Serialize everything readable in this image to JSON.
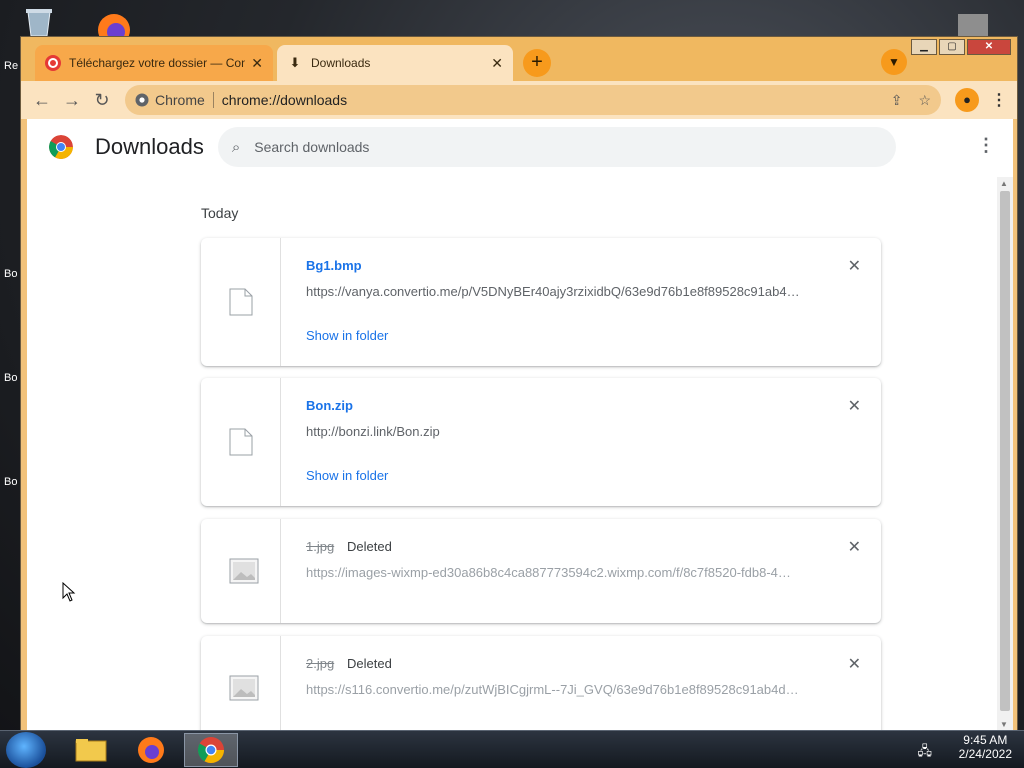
{
  "desktop": {
    "labels": [
      "Re",
      "Bo",
      "Bo",
      "Bo"
    ]
  },
  "browser": {
    "tabs": [
      {
        "title": "Téléchargez votre dossier — Con",
        "active": false
      },
      {
        "title": "Downloads",
        "active": true
      }
    ],
    "toolbar": {
      "site_label": "Chrome",
      "url": "chrome://downloads"
    }
  },
  "downloads": {
    "page_title": "Downloads",
    "search_placeholder": "Search downloads",
    "section": "Today",
    "items": [
      {
        "name": "Bg1.bmp",
        "url": "https://vanya.convertio.me/p/V5DNyBEr40ajy3rzixidbQ/63e9d76b1e8f89528c91ab4…",
        "action": "Show in folder",
        "status": "",
        "deleted": false
      },
      {
        "name": "Bon.zip",
        "url": "http://bonzi.link/Bon.zip",
        "action": "Show in folder",
        "status": "",
        "deleted": false
      },
      {
        "name": "1.jpg",
        "url": "https://images-wixmp-ed30a86b8c4ca887773594c2.wixmp.com/f/8c7f8520-fdb8-4…",
        "action": "",
        "status": "Deleted",
        "deleted": true
      },
      {
        "name": "2.jpg",
        "url": "https://s116.convertio.me/p/zutWjBICgjrmL--7Ji_GVQ/63e9d76b1e8f89528c91ab4d…",
        "action": "",
        "status": "Deleted",
        "deleted": true
      }
    ]
  },
  "taskbar": {
    "time": "9:45 AM",
    "date": "2/24/2022"
  },
  "colors": {
    "chrome_theme": "#f2c27a",
    "link_blue": "#1a73e8"
  }
}
